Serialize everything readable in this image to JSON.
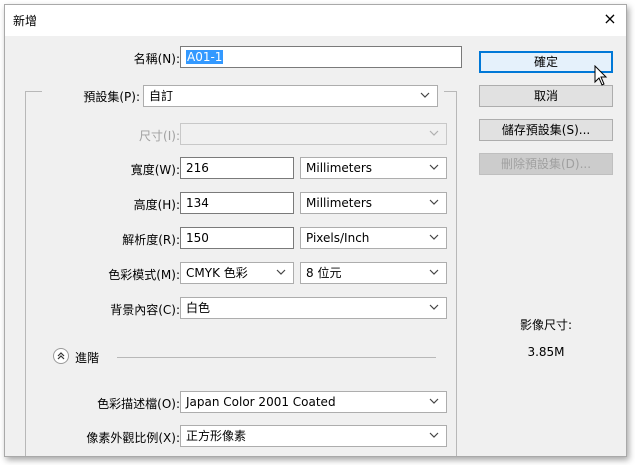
{
  "window": {
    "title": "新增",
    "close_glyph": "×"
  },
  "form": {
    "name": {
      "label": "名稱(N):",
      "value": "A01-1"
    },
    "preset": {
      "label": "預設集(P):",
      "value": "自訂"
    },
    "size": {
      "label": "尺寸(I):",
      "value": ""
    },
    "width": {
      "label": "寬度(W):",
      "value": "216",
      "unit": "Millimeters"
    },
    "height": {
      "label": "高度(H):",
      "value": "134",
      "unit": "Millimeters"
    },
    "resolution": {
      "label": "解析度(R):",
      "value": "150",
      "unit": "Pixels/Inch"
    },
    "color_mode": {
      "label": "色彩模式(M):",
      "value": "CMYK 色彩",
      "depth": "8 位元"
    },
    "background": {
      "label": "背景內容(C):",
      "value": "白色"
    },
    "advanced": {
      "label": "進階",
      "toggle_glyph": "︽"
    },
    "color_profile": {
      "label": "色彩描述檔(O):",
      "value": "Japan Color 2001 Coated"
    },
    "pixel_aspect": {
      "label": "像素外觀比例(X):",
      "value": "正方形像素"
    }
  },
  "buttons": {
    "ok": "確定",
    "cancel": "取消",
    "save_preset": "儲存預設集(S)...",
    "delete_preset": "刪除預設集(D)..."
  },
  "image_size": {
    "label": "影像尺寸:",
    "value": "3.85M"
  },
  "colors": {
    "selection": "#3399ff",
    "default_button_border": "#0078d7",
    "dialog_bg": "#f0f0f0"
  }
}
